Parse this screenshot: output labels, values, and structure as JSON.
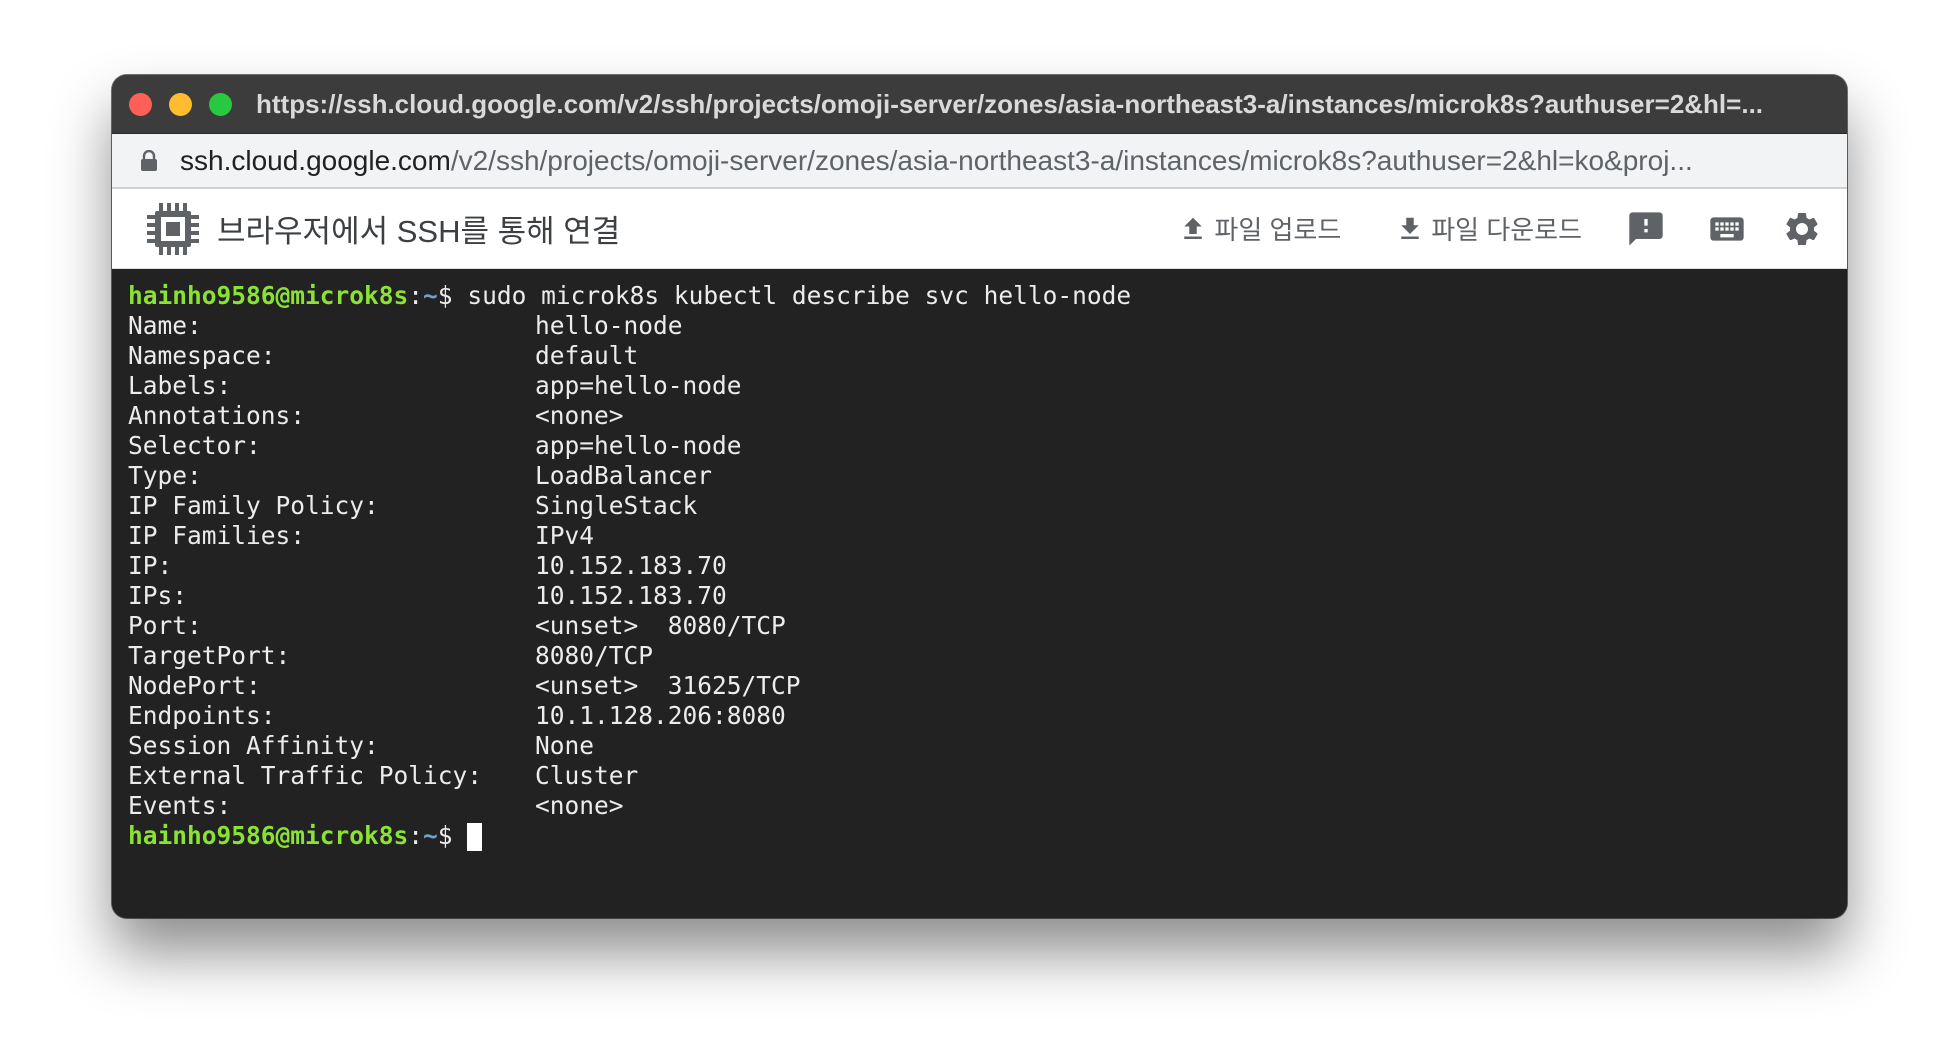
{
  "window": {
    "title": "https://ssh.cloud.google.com/v2/ssh/projects/omoji-server/zones/asia-northeast3-a/instances/microk8s?authuser=2&hl=..."
  },
  "address_bar": {
    "host": "ssh.cloud.google.com",
    "path": "/v2/ssh/projects/omoji-server/zones/asia-northeast3-a/instances/microk8s?authuser=2&hl=ko&proj..."
  },
  "toolbar": {
    "title": "브라우저에서 SSH를 통해 연결",
    "upload_label": "파일 업로드",
    "download_label": "파일 다운로드",
    "icons": [
      "chip-icon",
      "upload-icon",
      "download-icon",
      "feedback-icon",
      "keyboard-icon",
      "settings-icon"
    ]
  },
  "terminal": {
    "prompt_user": "hainho9586@microk8s",
    "prompt_sep": ":",
    "prompt_path": "~",
    "prompt_symbol": "$ ",
    "command": "sudo microk8s kubectl describe svc hello-node",
    "rows": [
      {
        "key": "Name:",
        "value": "hello-node"
      },
      {
        "key": "Namespace:",
        "value": "default"
      },
      {
        "key": "Labels:",
        "value": "app=hello-node"
      },
      {
        "key": "Annotations:",
        "value": "<none>"
      },
      {
        "key": "Selector:",
        "value": "app=hello-node"
      },
      {
        "key": "Type:",
        "value": "LoadBalancer"
      },
      {
        "key": "IP Family Policy:",
        "value": "SingleStack"
      },
      {
        "key": "IP Families:",
        "value": "IPv4"
      },
      {
        "key": "IP:",
        "value": "10.152.183.70"
      },
      {
        "key": "IPs:",
        "value": "10.152.183.70"
      },
      {
        "key": "Port:",
        "value": "<unset>  8080/TCP"
      },
      {
        "key": "TargetPort:",
        "value": "8080/TCP"
      },
      {
        "key": "NodePort:",
        "value": "<unset>  31625/TCP"
      },
      {
        "key": "Endpoints:",
        "value": "10.1.128.206:8080"
      },
      {
        "key": "Session Affinity:",
        "value": "None"
      },
      {
        "key": "External Traffic Policy:",
        "value": "Cluster"
      },
      {
        "key": "Events:",
        "value": "<none>"
      }
    ]
  },
  "colors": {
    "prompt_user": "#8ae234",
    "prompt_path": "#729fcf",
    "terminal_bg": "#222222",
    "terminal_fg": "#ececec"
  }
}
